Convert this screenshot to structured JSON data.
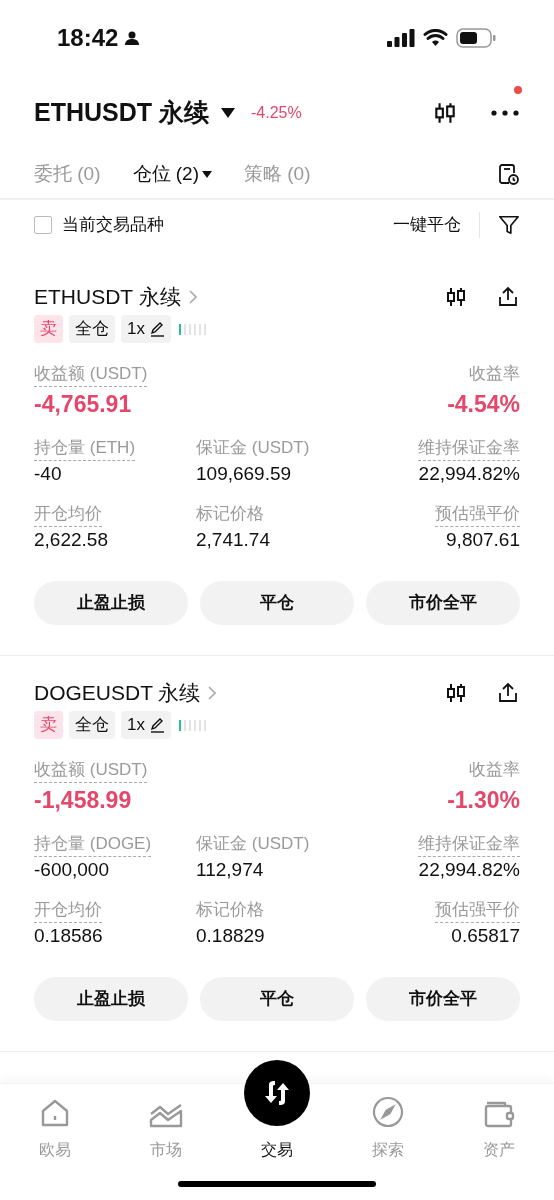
{
  "status_bar": {
    "time": "18:42"
  },
  "header": {
    "symbol": "ETHUSDT 永续",
    "change": "-4.25%",
    "more_badge": true
  },
  "tabs": [
    {
      "label": "委托 (0)",
      "selected": false,
      "dropdown": false
    },
    {
      "label": "仓位 (2)",
      "selected": true,
      "dropdown": true
    },
    {
      "label": "策略 (0)",
      "selected": false,
      "dropdown": false
    }
  ],
  "filter": {
    "label": "当前交易品种",
    "checked": false,
    "close_all": "一键平仓"
  },
  "positions": [
    {
      "name": "ETHUSDT 永续",
      "side": "卖",
      "margin_mode": "全仓",
      "leverage": "1x",
      "risk": {
        "level": 0.17
      },
      "pnl": {
        "label": "收益额 (USDT)",
        "value": "-4,765.91"
      },
      "roi": {
        "label": "收益率",
        "value": "-4.54%"
      },
      "fields": [
        {
          "label": "持仓量 (ETH)",
          "value": "-40",
          "dashed": true
        },
        {
          "label": "保证金 (USDT)",
          "value": "109,669.59",
          "dashed": false
        },
        {
          "label": "维持保证金率",
          "value": "22,994.82%",
          "dashed": true
        },
        {
          "label": "开仓均价",
          "value": "2,622.58",
          "dashed": true
        },
        {
          "label": "标记价格",
          "value": "2,741.74",
          "dashed": false
        },
        {
          "label": "预估强平价",
          "value": "9,807.61",
          "dashed": true
        }
      ],
      "buttons": [
        "止盈止损",
        "平仓",
        "市价全平"
      ]
    },
    {
      "name": "DOGEUSDT 永续",
      "side": "卖",
      "margin_mode": "全仓",
      "leverage": "1x",
      "risk": {
        "level": 0.17
      },
      "pnl": {
        "label": "收益额 (USDT)",
        "value": "-1,458.99"
      },
      "roi": {
        "label": "收益率",
        "value": "-1.30%"
      },
      "fields": [
        {
          "label": "持仓量 (DOGE)",
          "value": "-600,000",
          "dashed": true
        },
        {
          "label": "保证金 (USDT)",
          "value": "112,974",
          "dashed": false
        },
        {
          "label": "维持保证金率",
          "value": "22,994.82%",
          "dashed": true
        },
        {
          "label": "开仓均价",
          "value": "0.18586",
          "dashed": true
        },
        {
          "label": "标记价格",
          "value": "0.18829",
          "dashed": false
        },
        {
          "label": "预估强平价",
          "value": "0.65817",
          "dashed": true
        }
      ],
      "buttons": [
        "止盈止损",
        "平仓",
        "市价全平"
      ]
    }
  ],
  "bottom_nav": [
    {
      "label": "欧易",
      "selected": false
    },
    {
      "label": "市场",
      "selected": false
    },
    {
      "label": "交易",
      "selected": true
    },
    {
      "label": "探索",
      "selected": false
    },
    {
      "label": "资产",
      "selected": false
    }
  ]
}
